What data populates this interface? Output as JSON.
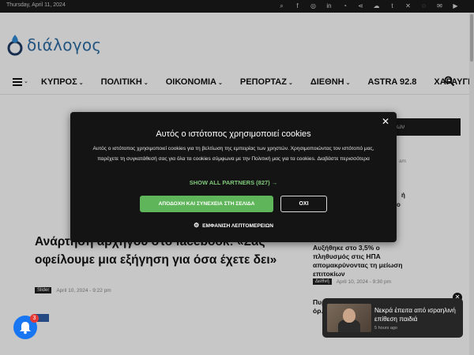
{
  "topbar": {
    "date": "Thursday, April 11, 2024",
    "icons": [
      "search-icon",
      "facebook-icon",
      "instagram-icon",
      "linkedin-icon",
      "rss-icon",
      "share-icon",
      "soundcloud-icon",
      "tumblr-icon",
      "x-icon",
      "whatsapp-icon",
      "mail-icon",
      "youtube-icon"
    ]
  },
  "logo": {
    "text": "διάλογος",
    "color": "#2e6da4"
  },
  "nav": {
    "items": [
      "ΚΥΠΡΟΣ",
      "ΠΟΛΙΤΙΚΗ",
      "ΟΙΚΟΝΟΜΙΑ",
      "ΡΕΠΟΡΤΑΖ",
      "ΔΙΕΘΝΗ",
      "ASTRA 92.8",
      "ΧΑΡΑΥΓΗ"
    ]
  },
  "background": {
    "dark_box_text": "ων",
    "headline": "Ανάρτηση αρχηγού στο facebook: «Σας οφείλουμε μια εξήγηση για όσα έχετε δει»",
    "headline_meta": {
      "tag": "Slider",
      "date": "April 10, 2024 - 9:22 pm"
    },
    "side_items": [
      {
        "title": "Αυξήθηκε στο 3,5% ο πληθυσμός στις ΗΠΑ απομακρύνοντας τη μείωση επιτοκίων",
        "tag": "Διεθνή",
        "date": "April 10, 2024 - 9:30 pm"
      },
      {
        "title": "Πυρκαγιά στο Δεύτερο όρ...",
        "tag": "",
        "date": ""
      }
    ],
    "fragments": [
      "am",
      "ή",
      "ο"
    ]
  },
  "consent": {
    "title": "Αυτός ο ιστότοπος χρησιμοποιεί cookies",
    "body": "Αυτός ο ιστότοπος χρησιμοποιεί cookies για τη βελτίωση της εμπειρίας των χρηστών. Χρησιμοποιώντας τον ιστότοπό μας, παρέχετε τη συγκατάθεσή σας για όλα τα cookies σύμφωνα με την Πολιτική μας για τα cookies. Διαβάστε περισσότερα",
    "partners": "SHOW ALL PARTNERS (827) →",
    "accept": "ΑΠΟΔΟΧΗ ΚΑΙ ΣΥΝΕΧΕΙΑ ΣΤΗ ΣΕΛΙΔΑ",
    "decline": "ΟΧΙ",
    "details": "ΕΜΦΑΝΙΣΗ ΛΕΠΤΟΜΕΡΕΙΩΝ",
    "accept_color": "#5fb55a",
    "partners_color": "#7fc87a"
  },
  "bell": {
    "count": "3",
    "color": "#1976f2"
  },
  "toast": {
    "text": "Νεκρά έπειτα από ισραηλινή επίθεση παιδιά",
    "time": "5 hours ago"
  }
}
